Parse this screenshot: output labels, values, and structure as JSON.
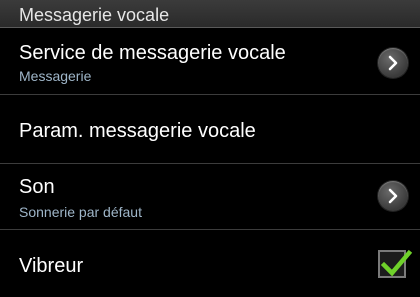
{
  "section": {
    "title": "Messagerie vocale"
  },
  "items": [
    {
      "title": "Service de messagerie vocale",
      "subtitle": "Messagerie",
      "control": "chevron-right-icon"
    },
    {
      "title": "Param. messagerie vocale",
      "subtitle": "",
      "control": ""
    },
    {
      "title": "Son",
      "subtitle": "Sonnerie par défaut",
      "control": "chevron-right-icon"
    },
    {
      "title": "Vibreur",
      "subtitle": "",
      "control": "checkbox",
      "checked": true
    }
  ],
  "colors": {
    "background": "#000000",
    "header_bg": "#333333",
    "subtitle": "#9fb6c9",
    "check": "#6fd12a"
  }
}
